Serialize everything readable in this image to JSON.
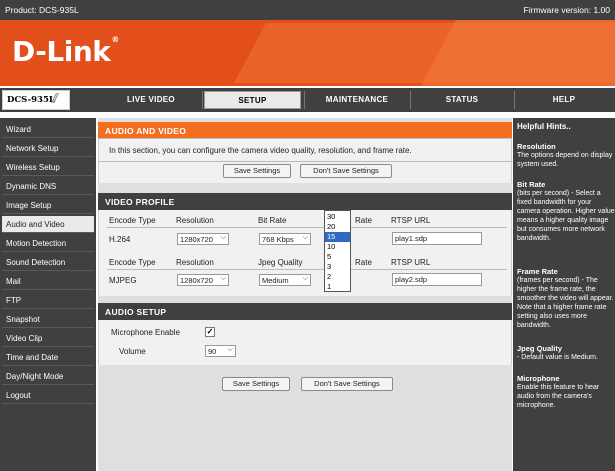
{
  "topbar": {
    "product": "Product: DCS-935L",
    "firmware": "Firmware version: 1.00"
  },
  "header": {
    "logo": "D-Link",
    "reg": "®"
  },
  "nav": {
    "model": "DCS-935L",
    "tabs": [
      "LIVE VIDEO",
      "SETUP",
      "MAINTENANCE",
      "STATUS",
      "HELP"
    ],
    "active_tab": "SETUP"
  },
  "sidebar": {
    "items": [
      "Wizard",
      "Network Setup",
      "Wireless Setup",
      "Dynamic DNS",
      "Image Setup",
      "Audio and Video",
      "Motion Detection",
      "Sound Detection",
      "Mail",
      "FTP",
      "Snapshot",
      "Video Clip",
      "Time and Date",
      "Day/Night Mode",
      "Logout"
    ],
    "active": "Audio and Video"
  },
  "audio_video": {
    "title": "AUDIO AND VIDEO",
    "description": "In this section, you can configure the camera video quality, resolution, and frame rate.",
    "save_label": "Save Settings",
    "dont_save_label": "Don't Save Settings"
  },
  "video_profile": {
    "title": "VIDEO PROFILE",
    "profile1": {
      "h_encode": "Encode Type",
      "h_resolution": "Resolution",
      "h_quality": "Bit Rate",
      "h_rate": "Rate",
      "h_rtsp": "RTSP URL",
      "encode": "H.264",
      "resolution": "1280x720",
      "quality": "768 Kbps",
      "rtsp": "play1.sdp"
    },
    "profile2": {
      "h_encode": "Encode Type",
      "h_resolution": "Resolution",
      "h_quality": "Jpeg Quality",
      "h_rate": "Rate",
      "h_rtsp": "RTSP URL",
      "encode": "MJPEG",
      "resolution": "1280x720",
      "quality": "Medium",
      "rtsp": "play2.sdp"
    },
    "framerate_options": [
      "30",
      "20",
      "15",
      "10",
      "5",
      "3",
      "2",
      "1"
    ],
    "framerate_selected": "15"
  },
  "audio_setup": {
    "title": "AUDIO SETUP",
    "mic_label": "Microphone Enable",
    "mic_checked": "✓",
    "volume_label": "Volume",
    "volume": "90"
  },
  "footer_buttons": {
    "save_label": "Save Settings",
    "dont_save_label": "Don't Save Settings"
  },
  "hints": {
    "title": "Helpful Hints..",
    "resolution_title": "Resolution",
    "resolution_body": "The options depend on display system used.",
    "bitrate_title": "Bit Rate",
    "bitrate_body": "(bits per second) - Select a fixed bandwidth for your camera operation. Higher value means a higher quality image but consumes more network bandwidth.",
    "framerate_title": "Frame Rate",
    "framerate_body": "(frames per second) - The higher the frame rate, the smoother the video will appear. Note that a higher frame rate setting also uses more bandwidth.",
    "jpeg_title": "Jpeg Quality",
    "jpeg_body": "- Default value is Medium.",
    "mic_title": "Microphone",
    "mic_body": "Enable this feature to hear audio from the camera's microphone."
  },
  "colors": {
    "brand_orange": "#e34f1a",
    "section_orange": "#f36f1f",
    "dark": "#404040",
    "selection": "#316ac5"
  }
}
